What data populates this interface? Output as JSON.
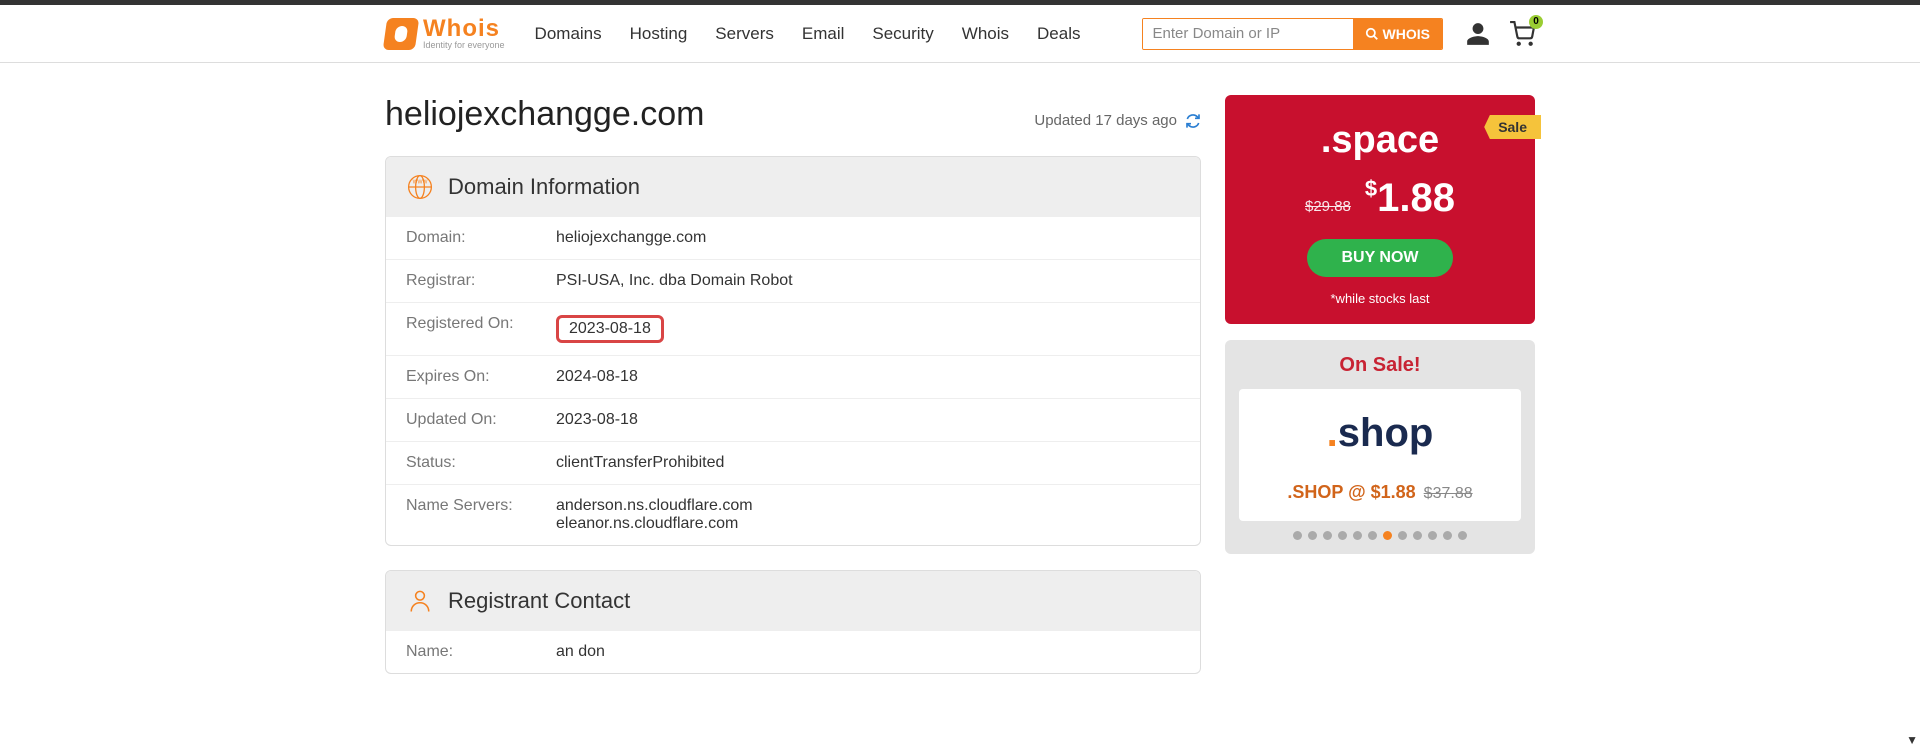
{
  "header": {
    "brand": "Whois",
    "tagline": "Identity for everyone",
    "nav": [
      "Domains",
      "Hosting",
      "Servers",
      "Email",
      "Security",
      "Whois",
      "Deals"
    ],
    "search_placeholder": "Enter Domain or IP",
    "search_button": "WHOIS",
    "cart_count": "0"
  },
  "page": {
    "title": "heliojexchangge.com",
    "updated": "Updated 17 days ago"
  },
  "domain_info": {
    "heading": "Domain Information",
    "rows": {
      "domain_label": "Domain:",
      "domain_value": "heliojexchangge.com",
      "registrar_label": "Registrar:",
      "registrar_value": "PSI-USA, Inc. dba Domain Robot",
      "registered_label": "Registered On:",
      "registered_value": "2023-08-18",
      "expires_label": "Expires On:",
      "expires_value": "2024-08-18",
      "updated_label": "Updated On:",
      "updated_value": "2023-08-18",
      "status_label": "Status:",
      "status_value": "clientTransferProhibited",
      "ns_label": "Name Servers:",
      "ns_value1": "anderson.ns.cloudflare.com",
      "ns_value2": "eleanor.ns.cloudflare.com"
    }
  },
  "registrant": {
    "heading": "Registrant Contact",
    "name_label": "Name:",
    "name_value": "an don"
  },
  "promo": {
    "ribbon": "Sale",
    "tld": ".space",
    "old_price": "$29.88",
    "new_price": "1.88",
    "dollar": "$",
    "buy": "BUY NOW",
    "note": "*while stocks last"
  },
  "onsale": {
    "title": "On Sale!",
    "logo_word": "shop",
    "deal_text": ".SHOP @ $1.88",
    "orig_price": "$37.88"
  }
}
